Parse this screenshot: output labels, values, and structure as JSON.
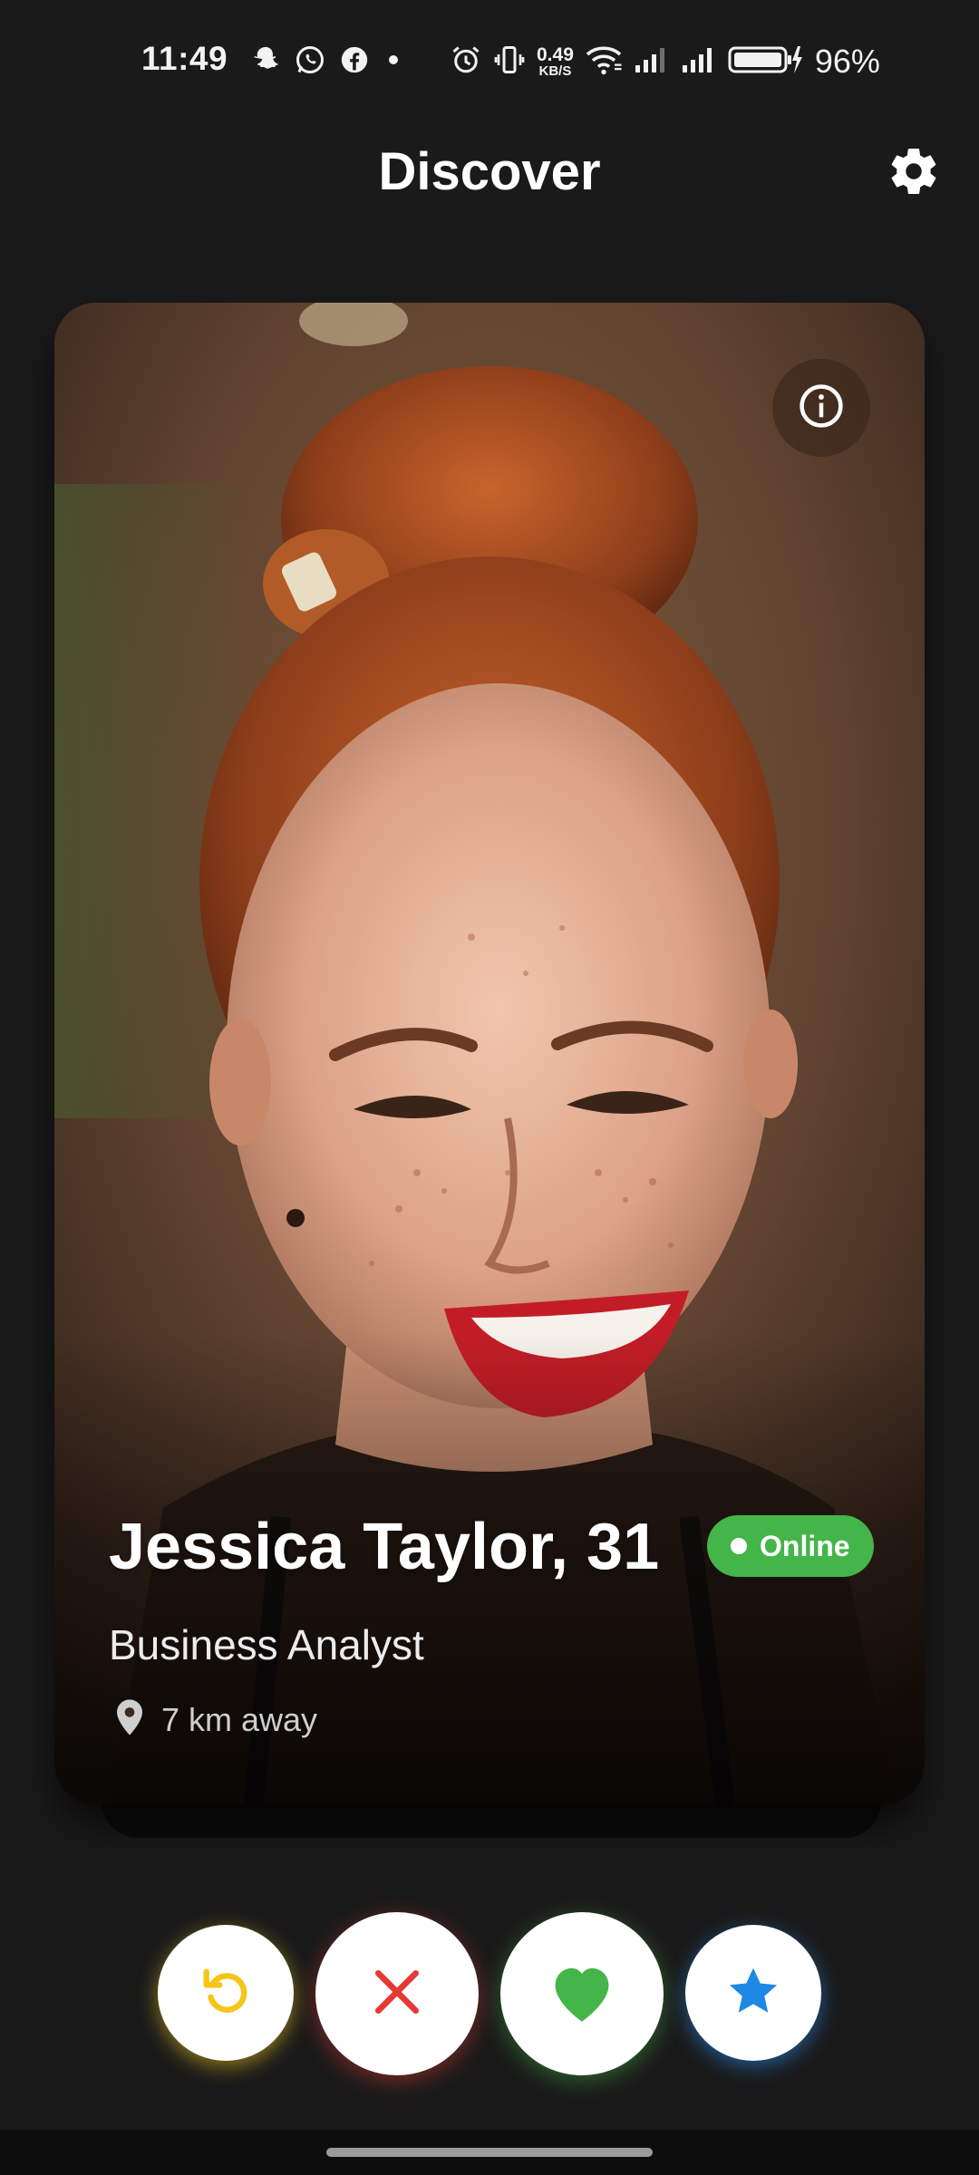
{
  "status_bar": {
    "time": "11:49",
    "net_speed_value": "0.49",
    "net_speed_unit": "KB/S",
    "battery_percent": "96%"
  },
  "header": {
    "title": "Discover"
  },
  "profile": {
    "name_age": "Jessica Taylor, 31",
    "status": "Online",
    "occupation": "Business Analyst",
    "distance": "7 km away"
  },
  "colors": {
    "background": "#1a1a1a",
    "online_badge": "#43b549",
    "rewind": "#f5c518",
    "nope": "#e53935",
    "like": "#43b549",
    "superlike": "#1e88e5"
  },
  "icons": {
    "settings": "gear-icon",
    "info": "info-icon",
    "location": "location-pin-icon",
    "rewind": "rewind-icon",
    "nope": "close-icon",
    "like": "heart-icon",
    "superlike": "star-icon"
  }
}
